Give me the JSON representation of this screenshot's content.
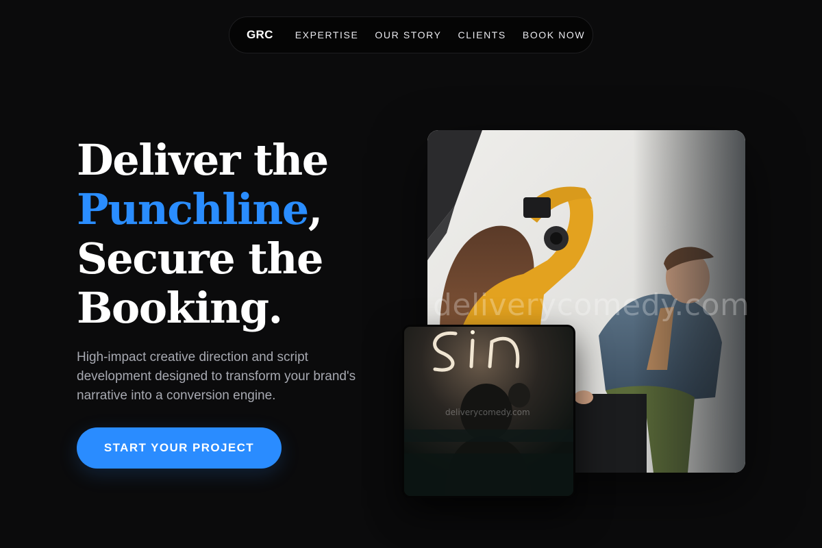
{
  "nav": {
    "logo": "GRC",
    "links": [
      "EXPERTISE",
      "OUR STORY",
      "CLIENTS",
      "BOOK NOW"
    ]
  },
  "hero": {
    "headline_line1": "Deliver the",
    "headline_accent": "Punchline",
    "headline_comma": ",",
    "headline_line3": "Secure the",
    "headline_line4": "Booking.",
    "subtext": "High-impact creative direction and script development designed to transform your brand's narrative into a conversion engine.",
    "cta_label": "START YOUR PROJECT"
  },
  "images": {
    "main_alt": "photo-shoot-photographer-and-model",
    "small_alt": "neon-sign-audience",
    "watermark": "deliverycomedy.com"
  },
  "colors": {
    "background": "#0b0b0c",
    "accent": "#2a8dff",
    "text_muted": "#a7a9b1"
  }
}
